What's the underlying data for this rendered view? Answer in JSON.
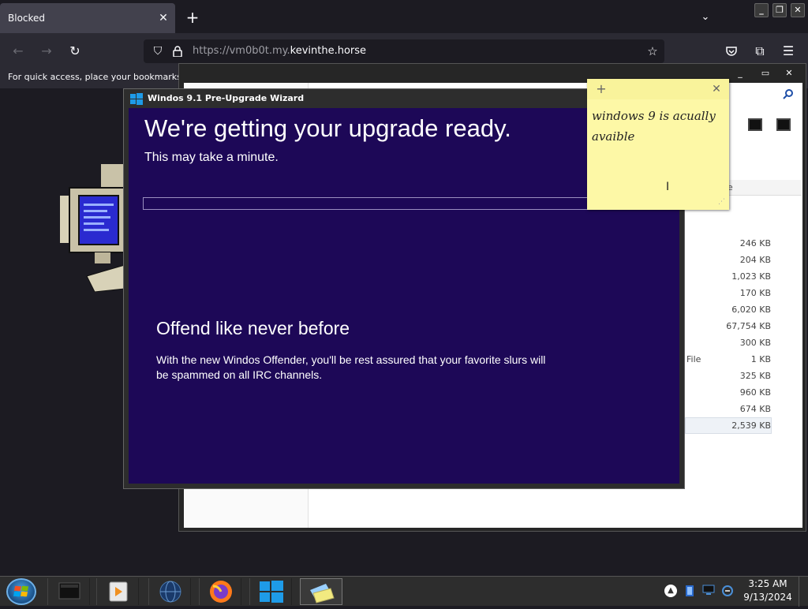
{
  "browser": {
    "tab_title": "Blocked",
    "tab_close": "✕",
    "new_tab": "+",
    "tab_list": "⌄",
    "url_scheme": "https://vm0b0t.my.",
    "url_host": "kevinthe.horse",
    "bookmarks_hint": "For quick access, place your bookmarks he",
    "nav": {
      "back": "←",
      "forward": "→",
      "reload": "↻"
    },
    "icons": {
      "shield": "⛉",
      "lock": "🔒",
      "star": "☆",
      "pocket": "◡",
      "extensions": "⧉",
      "menu": "☰"
    }
  },
  "os_window_controls": {
    "minimize": "_",
    "restore": "❐",
    "close": "✕"
  },
  "explorer": {
    "controls": {
      "minimize": "_",
      "maximize": "▭",
      "close": "✕"
    },
    "column_header": "e",
    "file_type_label": "File",
    "file_sizes": [
      "246 KB",
      "204 KB",
      "1,023 KB",
      "170 KB",
      "6,020 KB",
      "67,754 KB",
      "300 KB",
      "1 KB",
      "325 KB",
      "960 KB",
      "674 KB",
      "2,539 KB"
    ],
    "selected_index": 11
  },
  "wizard": {
    "title": "Windos 9.1 Pre-Upgrade Wizard",
    "heading": "We're getting your upgrade ready.",
    "subheading": "This may take a minute.",
    "progress": 0,
    "feature_title": "Offend like never before",
    "feature_desc": "With the new Windos Offender, you'll be rest assured that your favorite slurs will be spammed on all IRC channels.",
    "colors": {
      "body": "#1d0857",
      "logo": "#1e9be8"
    }
  },
  "sticky": {
    "add": "+",
    "close": "✕",
    "text": "windows 9 is acually avaible",
    "cursor": "I"
  },
  "taskbar": {
    "clock_time": "3:25 AM",
    "clock_date": "9/13/2024",
    "tray_up": "▲"
  }
}
